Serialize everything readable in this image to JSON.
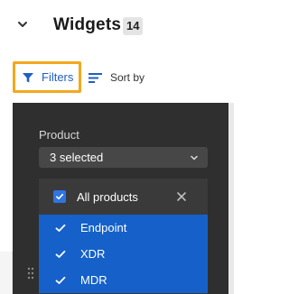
{
  "header": {
    "title": "Widgets",
    "count": "14"
  },
  "toolbar": {
    "filters_label": "Filters",
    "sort_label": "Sort by"
  },
  "filter_panel": {
    "product_label": "Product",
    "product_select_value": "3 selected",
    "options": [
      {
        "label": "All products",
        "checked": true
      },
      {
        "label": "Endpoint",
        "selected": true
      },
      {
        "label": "XDR",
        "selected": true
      },
      {
        "label": "MDR",
        "selected": true
      }
    ]
  },
  "colors": {
    "accent_blue": "#1561c9",
    "highlight_orange": "#f4a81d",
    "panel_dark": "#2f2f2f"
  },
  "icons": [
    "chevron-down-icon",
    "filter-icon",
    "sort-icon",
    "checkbox-checked-icon",
    "close-icon",
    "checkmark-icon",
    "drag-handle-icon"
  ]
}
